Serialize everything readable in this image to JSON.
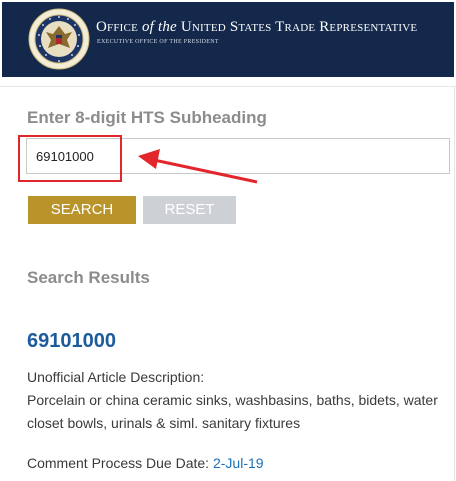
{
  "header": {
    "title_office": "Office",
    "title_of_the": "of the",
    "title_rest": "United States Trade Representative",
    "subtitle": "EXECUTIVE OFFICE OF THE PRESIDENT",
    "seal_icon": "presidential-seal-icon"
  },
  "search": {
    "label": "Enter 8-digit HTS Subheading",
    "value": "69101000",
    "search_button": "SEARCH",
    "reset_button": "RESET"
  },
  "annotation": {
    "highlight_color": "#e3262b",
    "arrow_icon": "red-arrow-icon"
  },
  "results": {
    "heading": "Search Results",
    "code": "69101000",
    "description_label": "Unofficial Article Description:",
    "description": "Porcelain or china ceramic sinks, washbasins, baths, bidets, water closet bowls, urinals & siml. sanitary fixtures",
    "due_label": "Comment Process Due Date:",
    "due_date": "2-Jul-19"
  },
  "colors": {
    "header_bg": "#13284b",
    "search_button": "#b8942b",
    "reset_button": "#cdd1d6",
    "link": "#1d5b9c"
  }
}
